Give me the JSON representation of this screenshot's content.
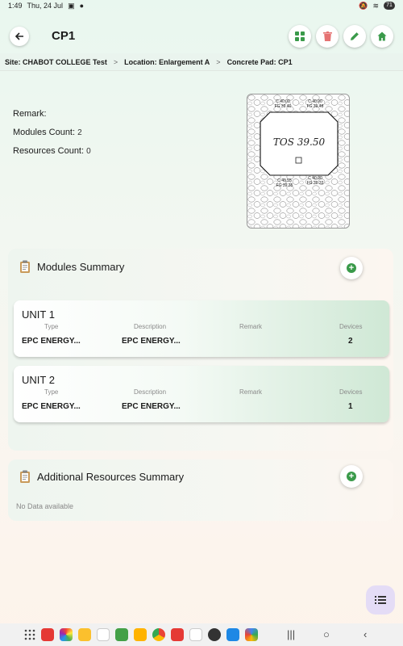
{
  "status_bar": {
    "time": "1:49",
    "date": "Thu, 24 Jul",
    "battery": "71"
  },
  "appbar": {
    "title": "CP1"
  },
  "breadcrumb": {
    "site": "Site: CHABOT COLLEGE Test",
    "location": "Location: Enlargement A",
    "pad": "Concrete Pad: CP1",
    "separator": ">"
  },
  "info": {
    "remark_label": "Remark:",
    "modules_label": "Modules Count:",
    "modules_count": "2",
    "resources_label": "Resources Count:",
    "resources_count": "0"
  },
  "sketch": {
    "tos": "TOS 39.50",
    "tl": "C 40.00",
    "tl2": "FG 39.40",
    "tr": "C 40.00",
    "tr2": "FG 39.48",
    "bl": "C 40.55",
    "bl2": "FG 39.35",
    "br": "C 40.00",
    "br2": "FG 39.33"
  },
  "modules": {
    "title": "Modules Summary",
    "columns": [
      "Type",
      "Description",
      "Remark",
      "Devices"
    ],
    "units": [
      {
        "name": "UNIT 1",
        "type": "EPC ENERGY...",
        "description": "EPC ENERGY...",
        "remark": "",
        "devices": "2"
      },
      {
        "name": "UNIT 2",
        "type": "EPC ENERGY...",
        "description": "EPC ENERGY...",
        "remark": "",
        "devices": "1"
      }
    ]
  },
  "resources": {
    "title": "Additional Resources Summary",
    "empty_text": "No Data available"
  },
  "colors": {
    "accent_green": "#3a9a4a",
    "delete_red": "#e57373",
    "fab_bg": "#e4dcf6"
  }
}
